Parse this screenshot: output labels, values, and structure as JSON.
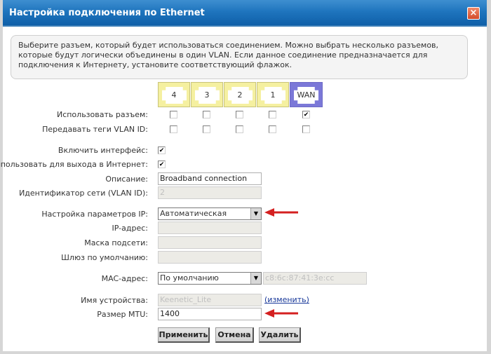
{
  "window": {
    "title": "Настройка подключения по Ethernet",
    "close_icon": "close-icon"
  },
  "info": {
    "text": "Выберите разъем, который будет использоваться соединением. Можно выбрать несколько разъемов, которые будут логически объединены в один VLAN. Если данное соединение предназначается для подключения к Интернету, установите соответствующий флажок."
  },
  "ports": {
    "items": [
      {
        "label": "4",
        "use": false,
        "vlan_tag": false
      },
      {
        "label": "3",
        "use": false,
        "vlan_tag": false
      },
      {
        "label": "2",
        "use": false,
        "vlan_tag": false
      },
      {
        "label": "1",
        "use": false,
        "vlan_tag": false
      },
      {
        "label": "WAN",
        "use": true,
        "vlan_tag": false
      }
    ],
    "use_label": "Использовать разъем:",
    "vlan_tag_label": "Передавать теги VLAN ID:",
    "colors": {
      "lan": "#f5f0a0",
      "wan": "#7b78d8"
    }
  },
  "form": {
    "enable_interface": {
      "label": "Включить интерфейс:",
      "checked": true
    },
    "use_for_internet": {
      "label": "Использовать для выхода в Интернет:",
      "checked": true
    },
    "description": {
      "label": "Описание:",
      "value": "Broadband connection"
    },
    "vlan_id": {
      "label": "Идентификатор сети (VLAN ID):",
      "value": "2"
    },
    "ip_settings": {
      "label": "Настройка параметров IP:",
      "value": "Автоматическая"
    },
    "ip_address": {
      "label": "IP-адрес:",
      "value": ""
    },
    "subnet_mask": {
      "label": "Маска подсети:",
      "value": ""
    },
    "gateway": {
      "label": "Шлюз по умолчанию:",
      "value": ""
    },
    "mac_address": {
      "label": "MAC-адрес:",
      "value": "По умолчанию",
      "mac_value": "c8:6c:87:41:3e:cc"
    },
    "device_name": {
      "label": "Имя устройства:",
      "value": "Keenetic_Lite",
      "change_link": "(изменить)"
    },
    "mtu": {
      "label": "Размер MTU:",
      "value": "1400"
    }
  },
  "buttons": {
    "apply": "Применить",
    "cancel": "Отмена",
    "delete": "Удалить"
  },
  "annotations": {
    "arrow_color": "#d42020"
  }
}
